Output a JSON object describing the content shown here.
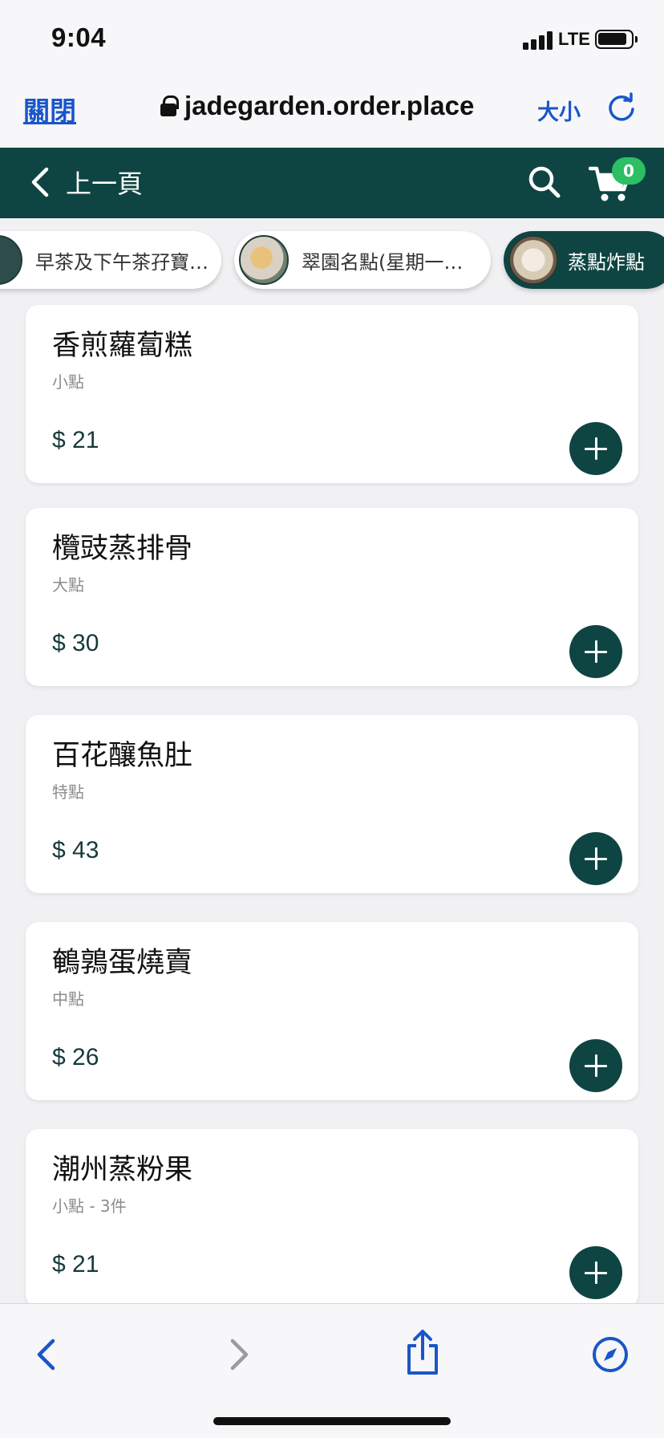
{
  "status_bar": {
    "time": "9:04",
    "network": "LTE"
  },
  "browser": {
    "close_label": "關閉",
    "url": "jadegarden.order.place",
    "text_size_label": "大小"
  },
  "header": {
    "back_label": "上一頁",
    "cart_count": "0"
  },
  "categories": [
    {
      "label": "早茶及下午茶孖寶…",
      "active": false
    },
    {
      "label": "翠園名點(星期一…",
      "active": false
    },
    {
      "label": "蒸點炸點",
      "active": true
    }
  ],
  "items": [
    {
      "name": "香煎蘿蔔糕",
      "size": "小點",
      "price": "$ 21"
    },
    {
      "name": "欖豉蒸排骨",
      "size": "大點",
      "price": "$ 30"
    },
    {
      "name": "百花釀魚肚",
      "size": "特點",
      "price": "$ 43"
    },
    {
      "name": "鵪鶉蛋燒賣",
      "size": "中點",
      "price": "$ 26"
    },
    {
      "name": "潮州蒸粉果",
      "size": "小點 - 3件",
      "price": "$ 21"
    }
  ],
  "colors": {
    "brand": "#0e4542",
    "badge": "#2dbf63",
    "link": "#1a56c8"
  },
  "icons": [
    "lock-icon",
    "reload-icon",
    "back-chevron-icon",
    "search-icon",
    "cart-icon",
    "plus-icon",
    "browser-back-icon",
    "browser-forward-icon",
    "share-icon",
    "compass-icon"
  ]
}
